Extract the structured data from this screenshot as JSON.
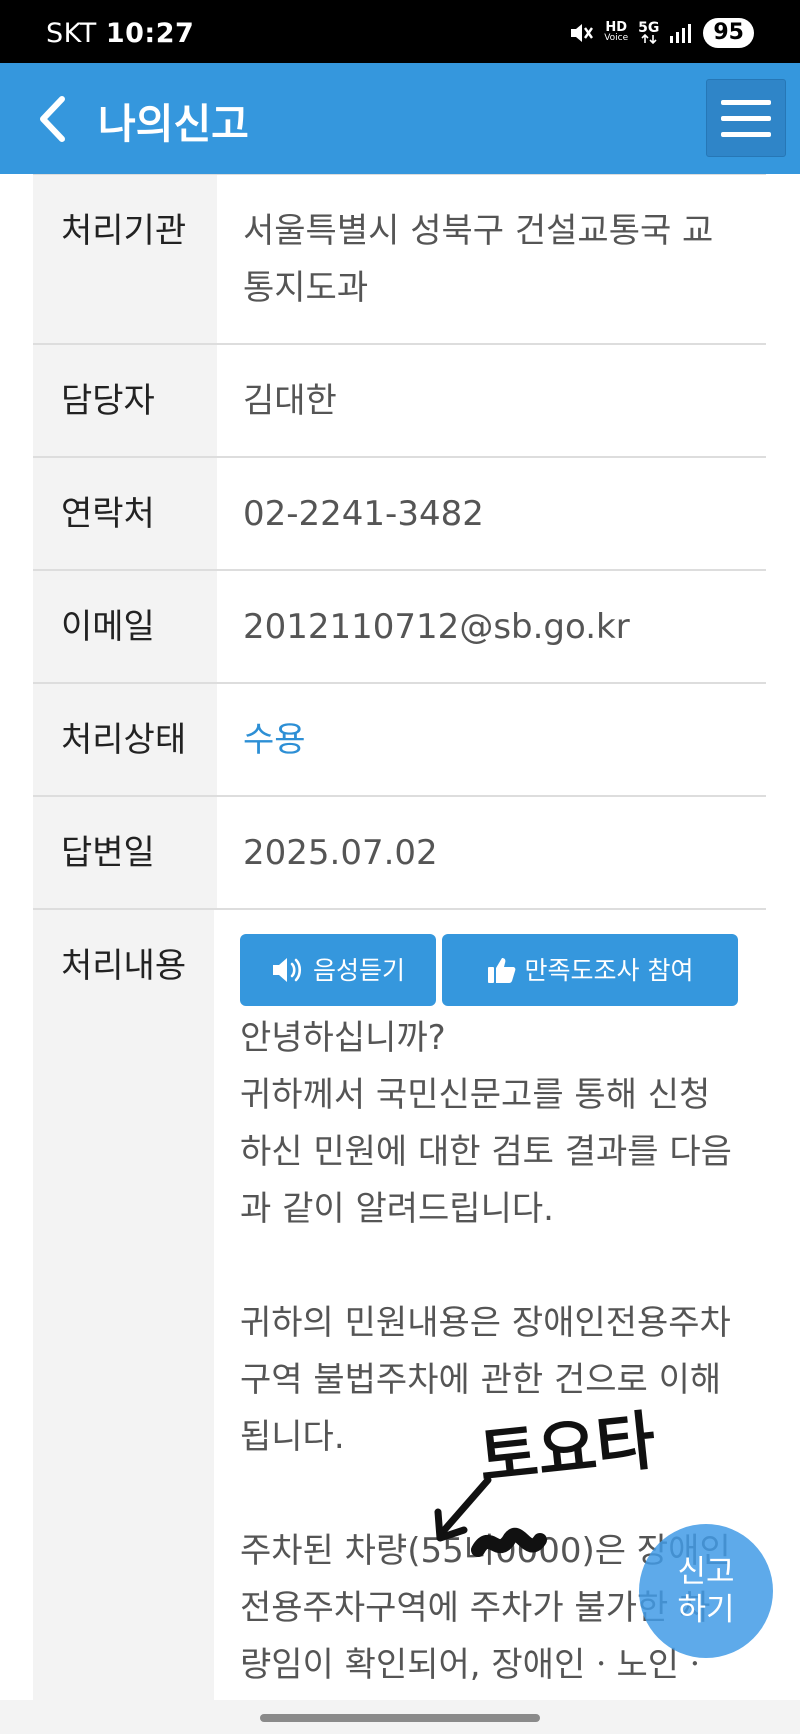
{
  "status_bar": {
    "carrier": "SKT",
    "time": "10:27",
    "hd_line1": "HD",
    "hd_line2": "Voice",
    "network": "5G",
    "battery": "95"
  },
  "header": {
    "title": "나의신고"
  },
  "details": [
    {
      "label": "처리기관",
      "value": "서울특별시 성북구 건설교통국 교통지도과"
    },
    {
      "label": "담당자",
      "value": "김대한"
    },
    {
      "label": "연락처",
      "value": "02-2241-3482"
    },
    {
      "label": "이메일",
      "value": "2012110712@sb.go.kr"
    },
    {
      "label": "처리상태",
      "value": "수용"
    },
    {
      "label": "답변일",
      "value": "2025.07.02"
    }
  ],
  "content_section": {
    "label": "처리내용",
    "listen_button": "음성듣기",
    "survey_button": "만족도조사 참여",
    "paragraphs": [
      "안녕하십니까?",
      "귀하께서 국민신문고를 통해 신청하신 민원에 대한 검토 결과를 다음과 같이 알려드립니다.",
      "",
      "귀하의 민원내용은 장애인전용주차구역 불법주차에 관한 건으로 이해됩니다.",
      "",
      "주차된 차량(55너0000)은 장애인전용주차구역에 주차가 불가한 차량임이 확인되어, 장애인ㆍ노인ㆍ"
    ]
  },
  "fab": {
    "line1": "신고",
    "line2": "하기"
  },
  "handwriting": "토요타",
  "colors": {
    "header_bg": "#3597dd",
    "accent": "#2d8fd5",
    "label_bg": "#f3f3f3"
  }
}
